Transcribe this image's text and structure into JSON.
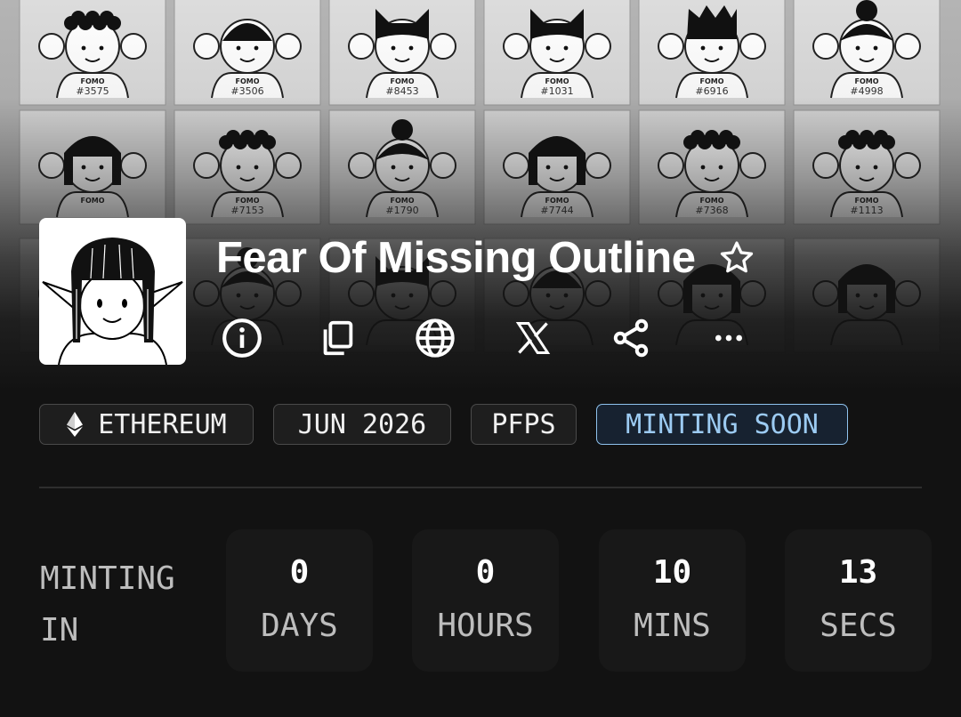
{
  "collection": {
    "title": "Fear Of Missing Outline"
  },
  "banner": {
    "tiles": [
      {
        "label": "FOMO",
        "number": "#3575"
      },
      {
        "label": "FOMO",
        "number": "#3506"
      },
      {
        "label": "FOMO",
        "number": "#8453"
      },
      {
        "label": "FOMO",
        "number": "#1031"
      },
      {
        "label": "FOMO",
        "number": "#6916"
      },
      {
        "label": "FOMO",
        "number": "#4998"
      },
      {
        "label": "FOMO",
        "number": ""
      },
      {
        "label": "FOMO",
        "number": "#7153"
      },
      {
        "label": "FOMO",
        "number": "#1790"
      },
      {
        "label": "FOMO",
        "number": "#7744"
      },
      {
        "label": "FOMO",
        "number": "#7368"
      },
      {
        "label": "FOMO",
        "number": "#1113"
      }
    ]
  },
  "actions": {
    "icons": [
      "info-icon",
      "copy-icon",
      "globe-icon",
      "x-icon",
      "share-icon",
      "more-icon"
    ]
  },
  "tags": {
    "chain_icon": "ethereum-icon",
    "chain": "ETHEREUM",
    "date": "JUN 2026",
    "category": "PFPS",
    "status": "MINTING SOON",
    "status_color": "#9ccbf2"
  },
  "countdown": {
    "label_line1": "MINTING",
    "label_line2": "IN",
    "days": {
      "value": "0",
      "unit": "DAYS"
    },
    "hours": {
      "value": "0",
      "unit": "HOURS"
    },
    "mins": {
      "value": "10",
      "unit": "MINS"
    },
    "secs": {
      "value": "13",
      "unit": "SECS"
    }
  }
}
